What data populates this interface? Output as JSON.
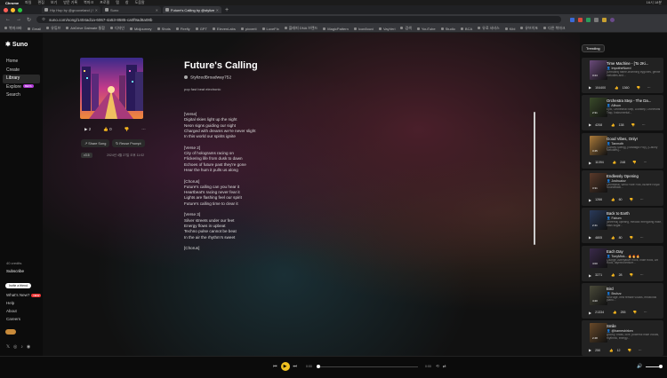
{
  "macbar": {
    "app": "Chrome",
    "menus": [
      "파일",
      "편집",
      "보기",
      "방문 기록",
      "북마크",
      "프로필",
      "탭",
      "창",
      "도움말"
    ],
    "clock": "16시 18분"
  },
  "tabs": [
    {
      "label": "Hip Hop by @grooveland | Suno",
      "active": false
    },
    {
      "label": "Suno",
      "active": false
    },
    {
      "label": "Future's Calling by @stylized",
      "active": true
    }
  ],
  "address": {
    "url": "suno.com/song/1404ad1a-6067-4a53-8585-ca0f9ad8a08b"
  },
  "bookmarks": [
    "북마크바",
    "Gmail",
    "유튜브",
    "AirDrive Dalmate 통합",
    "디자인",
    "Midjourney",
    "Shots",
    "Firefly",
    "GPT",
    "ElevenLabs",
    "pixverti",
    "LoveFIx",
    "플래피 DNA 브랜드",
    "MagicPattern",
    "Icon8ouvi",
    "VayVeri",
    "검색",
    "YouTube",
    "Studio",
    "BCA",
    "유료 서비스",
    "Kibl",
    "유브이포",
    "다른 북마크"
  ],
  "sidebar": {
    "logo": "Suno",
    "items": [
      {
        "label": "Home",
        "active": false
      },
      {
        "label": "Create",
        "active": false
      },
      {
        "label": "Library",
        "active": true
      },
      {
        "label": "Explore",
        "active": false,
        "badge": "BETA"
      },
      {
        "label": "Search",
        "active": false
      }
    ],
    "credits": "40 credits",
    "subscribe": "Subscribe",
    "invite": "Invite a friend",
    "links": [
      {
        "label": "What's New?",
        "badge": "NEW"
      },
      {
        "label": "Help"
      },
      {
        "label": "About"
      },
      {
        "label": "Careers"
      }
    ]
  },
  "song": {
    "title": "Future's Calling",
    "author": "StylizedBroadway752",
    "style": "pop fast beat electronic",
    "stats": {
      "plays": "2",
      "likes": "0"
    },
    "share_label": "Share Song",
    "reuse_label": "Reuse Prompt",
    "version": "v3.5",
    "date": "2024년 4월 27일 오후 11:02",
    "lyrics": "[Verse]\nDigital skies light up the night\nNeon signs guiding our sight\nCharged with dreams we're never slight\nIn this world our spirits ignite\n\n[Verse 2]\nCity of holograms racing on\nFlickering life from dusk to dawn\nEchoes of future past they're gone\nHear the hum it pulls us along\n\n[Chorus]\nFuture's calling can you hear it\nHeartbeat's racing never fear it\nLights are flashing feel our spirit\nFuture's calling time to clear it\n\n[Verse 3]\nSilver streets under our feet\nEnergy flows in upbeat\nTechno pulse cannot be beat\nIn the air the rhythm's sweet\n\n[Chorus]"
  },
  "trending": {
    "label": "Trending",
    "cards": [
      {
        "title": "Time Machine - [To 2Ki...",
        "author": "ImpotheNurrd",
        "desc": "[Onboard] flame-charming bygones, gentle melodies and...",
        "duration": "3:24",
        "plays": "104400",
        "likes": "1360",
        "color": "#6a4a7a"
      },
      {
        "title": "Orchestra Step - The Da...",
        "author": "Allison",
        "desc": "Epic, Orchestral Step, Dubstep, Orchestral Trap, Instrumental...",
        "duration": "2:31",
        "plays": "4208",
        "likes": "138",
        "color": "#3a4a2a"
      },
      {
        "title": "Good Vibes, Only!",
        "author": "Tanmoth",
        "desc": "[Swoley Swing], [Nostalgic Pop], [Catchy Melodies]...",
        "duration": "3:45",
        "plays": "11094",
        "likes": "248",
        "color": "#aa7a3a"
      },
      {
        "title": "Endlessly Opening",
        "author": "Joshuaiov",
        "desc": "Orchestral, Wind Flute Folk, Bizarre Royal Soundtrack...",
        "duration": "3:31",
        "plays": "1266",
        "likes": "60",
        "color": "#5a3a2a"
      },
      {
        "title": "Back to Earth",
        "author": "Fabum",
        "desc": "[cheerful] uplifting, melodic energizing ease, bass sugar...",
        "duration": "2:41",
        "plays": "4805",
        "likes": "80",
        "color": "#2a3a5a"
      },
      {
        "title": "Each Day",
        "author": "TonyMick... 🔥🔥🔥",
        "desc": "Lounge, Alternative Rock, Indie Rock, Art Rock, layered texture...",
        "duration": "4:00",
        "plays": "3271",
        "likes": "28",
        "color": "#3a2a4a"
      },
      {
        "title": "Bird",
        "author": "Bruhzz",
        "desc": "New age, new female vocals, emotional piano...",
        "duration": "4:20",
        "plays": "21334",
        "likes": "255",
        "color": "#4a4a3a"
      },
      {
        "title": "Smile",
        "author": "@hamesbirken",
        "desc": "groovy, brass, love, powerful male vocals, rhythmic, energy...",
        "duration": "2:48",
        "plays": "250",
        "likes": "12",
        "color": "#6a4a2a"
      }
    ]
  },
  "player": {
    "time_current": "0:00",
    "time_total": "0:00"
  }
}
